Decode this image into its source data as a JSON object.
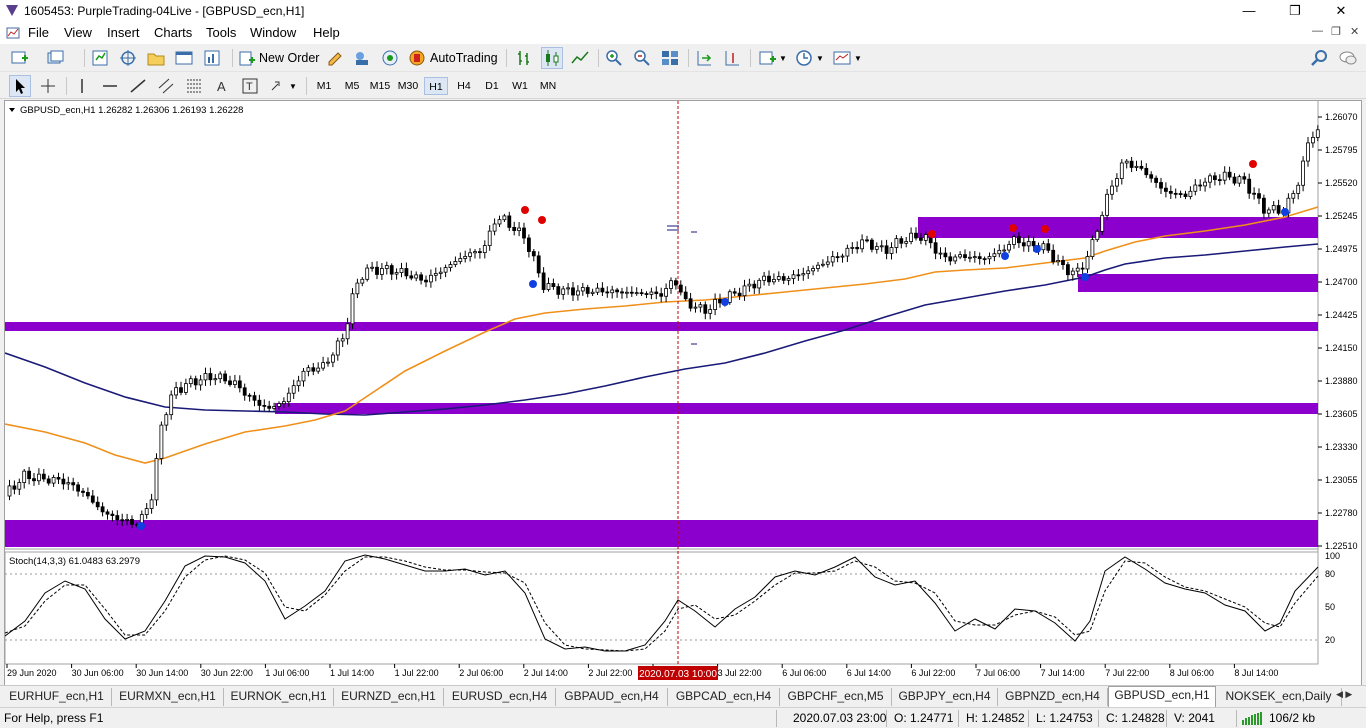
{
  "window": {
    "title": "1605453: PurpleTrading-04Live - [GBPUSD_ecn,H1]",
    "minimize": "—",
    "maximize": "❐",
    "close": "✕"
  },
  "menu": [
    "File",
    "View",
    "Insert",
    "Charts",
    "Tools",
    "Window",
    "Help"
  ],
  "toolbar": {
    "new_order_label": "New Order",
    "autotrading_label": "AutoTrading"
  },
  "timeframes": [
    "M1",
    "M5",
    "M15",
    "M30",
    "H1",
    "H4",
    "D1",
    "W1",
    "MN"
  ],
  "active_timeframe": "H1",
  "chart": {
    "header": "GBPUSD_ecn,H1  1.26282 1.26306 1.26193 1.26228",
    "price_labels": [
      "1.26070",
      "1.25795",
      "1.25520",
      "1.25245",
      "1.24975",
      "1.24700",
      "1.24425",
      "1.24150",
      "1.23880",
      "1.23605",
      "1.23330",
      "1.23055",
      "1.22780",
      "1.22510"
    ],
    "time_labels": [
      "29 Jun 2020",
      "30 Jun 06:00",
      "30 Jun 14:00",
      "30 Jun 22:00",
      "1 Jul 06:00",
      "1 Jul 14:00",
      "1 Jul 22:00",
      "2 Jul 06:00",
      "2 Jul 14:00",
      "2 Jul 22:00",
      "Jul 14:00",
      "3 Jul 22:00",
      "6 Jul 06:00",
      "6 Jul 14:00",
      "6 Jul 22:00",
      "7 Jul 06:00",
      "7 Jul 14:00",
      "7 Jul 22:00",
      "8 Jul 06:00",
      "8 Jul 14:00"
    ],
    "crosshair_time": "2020.07.03 10:00",
    "stoch_header": "Stoch(14,3,3) 61.0483 63.2979",
    "stoch_levels": [
      "100",
      "80",
      "50",
      "20",
      "0"
    ],
    "colors": {
      "zone": "#8b00cc",
      "ma_fast": "#f0901a",
      "ma_slow": "#1a1a78",
      "crosshair": "#c00000",
      "up_dot": "#1040e0",
      "down_dot": "#e00000"
    }
  },
  "tabs": [
    "EURHUF_ecn,H1",
    "EURMXN_ecn,H1",
    "EURNOK_ecn,H1",
    "EURNZD_ecn,H1",
    "EURUSD_ecn,H4",
    "GBPAUD_ecn,H4",
    "GBPCAD_ecn,H4",
    "GBPCHF_ecn,M5",
    "GBPJPY_ecn,H4",
    "GBPNZD_ecn,H4",
    "GBPUSD_ecn,H1",
    "NOKSEK_ecn,Daily"
  ],
  "active_tab": "GBPUSD_ecn,H1",
  "status": {
    "help": "For Help, press F1",
    "datetime": "2020.07.03 23:00",
    "open": "O: 1.24771",
    "high": "H: 1.24852",
    "low": "L: 1.24753",
    "close": "C: 1.24828",
    "volume": "V: 2041",
    "traffic": "106/2 kb"
  }
}
